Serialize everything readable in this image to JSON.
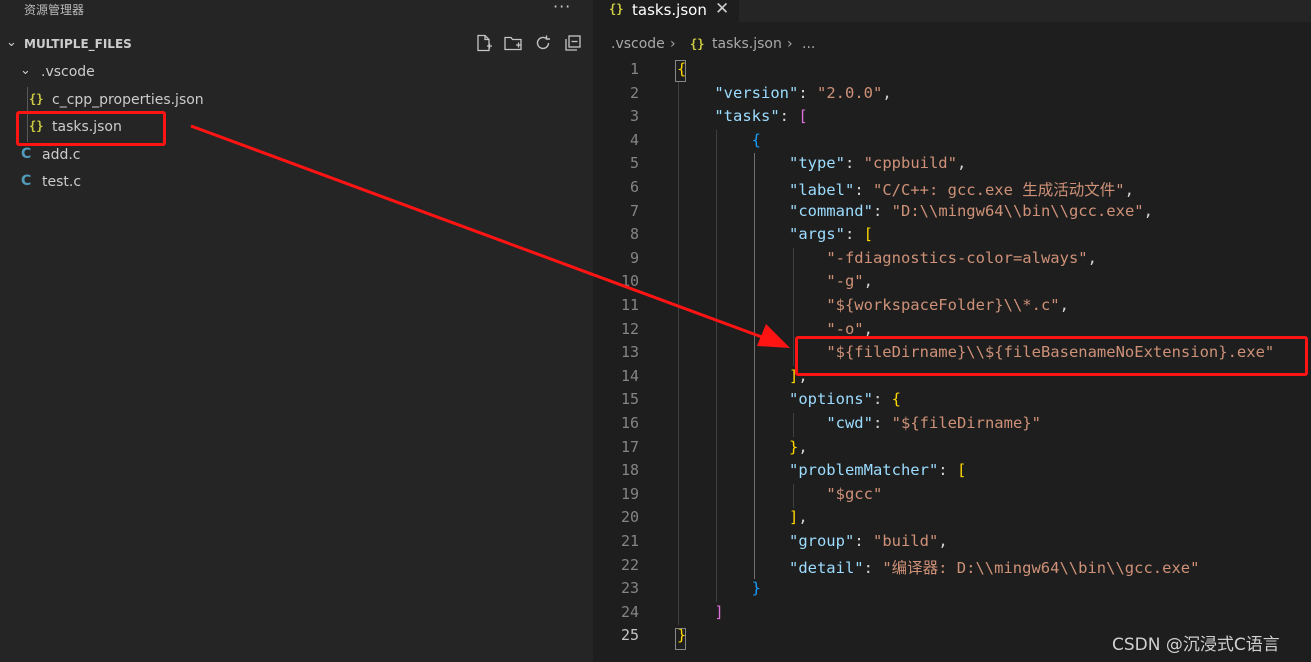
{
  "sidebar": {
    "title": "资源管理器",
    "more": "···",
    "section": {
      "name": "MULTIPLE_FILES"
    },
    "actions": [
      "new-file-icon",
      "new-folder-icon",
      "refresh-icon",
      "collapse-all-icon"
    ],
    "tree": [
      {
        "label": ".vscode",
        "type": "folder"
      },
      {
        "label": "c_cpp_properties.json",
        "type": "json",
        "icon": "{}"
      },
      {
        "label": "tasks.json",
        "type": "json",
        "icon": "{}"
      },
      {
        "label": "add.c",
        "type": "c",
        "icon": "C"
      },
      {
        "label": "test.c",
        "type": "c",
        "icon": "C"
      }
    ]
  },
  "editor": {
    "tab": {
      "icon": "{}",
      "label": "tasks.json",
      "close": "✕"
    },
    "breadcrumb": {
      "folder": ".vscode",
      "sep": "›",
      "icon": "{}",
      "file": "tasks.json",
      "rest": "..."
    },
    "code": [
      {
        "n": "1",
        "t": [
          [
            "b1",
            "{"
          ]
        ]
      },
      {
        "n": "2",
        "t": [
          [
            "p",
            "    "
          ],
          [
            "k",
            "\"version\""
          ],
          [
            "p",
            ": "
          ],
          [
            "s",
            "\"2.0.0\""
          ],
          [
            "p",
            ","
          ]
        ]
      },
      {
        "n": "3",
        "t": [
          [
            "p",
            "    "
          ],
          [
            "k",
            "\"tasks\""
          ],
          [
            "p",
            ": "
          ],
          [
            "b2",
            "["
          ]
        ]
      },
      {
        "n": "4",
        "t": [
          [
            "p",
            "        "
          ],
          [
            "b3",
            "{"
          ]
        ]
      },
      {
        "n": "5",
        "t": [
          [
            "p",
            "            "
          ],
          [
            "k",
            "\"type\""
          ],
          [
            "p",
            ": "
          ],
          [
            "s",
            "\"cppbuild\""
          ],
          [
            "p",
            ","
          ]
        ]
      },
      {
        "n": "6",
        "t": [
          [
            "p",
            "            "
          ],
          [
            "k",
            "\"label\""
          ],
          [
            "p",
            ": "
          ],
          [
            "s",
            "\"C/C++: gcc.exe 生成活动文件\""
          ],
          [
            "p",
            ","
          ]
        ]
      },
      {
        "n": "7",
        "t": [
          [
            "p",
            "            "
          ],
          [
            "k",
            "\"command\""
          ],
          [
            "p",
            ": "
          ],
          [
            "s",
            "\"D:\\\\mingw64\\\\bin\\\\gcc.exe\""
          ],
          [
            "p",
            ","
          ]
        ]
      },
      {
        "n": "8",
        "t": [
          [
            "p",
            "            "
          ],
          [
            "k",
            "\"args\""
          ],
          [
            "p",
            ": "
          ],
          [
            "b1",
            "["
          ]
        ]
      },
      {
        "n": "9",
        "t": [
          [
            "p",
            "                "
          ],
          [
            "s",
            "\"-fdiagnostics-color=always\""
          ],
          [
            "p",
            ","
          ]
        ]
      },
      {
        "n": "10",
        "t": [
          [
            "p",
            "                "
          ],
          [
            "s",
            "\"-g\""
          ],
          [
            "p",
            ","
          ]
        ]
      },
      {
        "n": "11",
        "t": [
          [
            "p",
            "                "
          ],
          [
            "s",
            "\"${workspaceFolder}\\\\*.c\""
          ],
          [
            "p",
            ","
          ]
        ]
      },
      {
        "n": "12",
        "t": [
          [
            "p",
            "                "
          ],
          [
            "s",
            "\"-o\""
          ],
          [
            "p",
            ","
          ]
        ]
      },
      {
        "n": "13",
        "t": [
          [
            "p",
            "                "
          ],
          [
            "s",
            "\"${fileDirname}\\\\${fileBasenameNoExtension}.exe\""
          ]
        ]
      },
      {
        "n": "14",
        "t": [
          [
            "p",
            "            "
          ],
          [
            "b1",
            "]"
          ],
          [
            "p",
            ","
          ]
        ]
      },
      {
        "n": "15",
        "t": [
          [
            "p",
            "            "
          ],
          [
            "k",
            "\"options\""
          ],
          [
            "p",
            ": "
          ],
          [
            "b1",
            "{"
          ]
        ]
      },
      {
        "n": "16",
        "t": [
          [
            "p",
            "                "
          ],
          [
            "k",
            "\"cwd\""
          ],
          [
            "p",
            ": "
          ],
          [
            "s",
            "\"${fileDirname}\""
          ]
        ]
      },
      {
        "n": "17",
        "t": [
          [
            "p",
            "            "
          ],
          [
            "b1",
            "}"
          ],
          [
            "p",
            ","
          ]
        ]
      },
      {
        "n": "18",
        "t": [
          [
            "p",
            "            "
          ],
          [
            "k",
            "\"problemMatcher\""
          ],
          [
            "p",
            ": "
          ],
          [
            "b1",
            "["
          ]
        ]
      },
      {
        "n": "19",
        "t": [
          [
            "p",
            "                "
          ],
          [
            "s",
            "\"$gcc\""
          ]
        ]
      },
      {
        "n": "20",
        "t": [
          [
            "p",
            "            "
          ],
          [
            "b1",
            "]"
          ],
          [
            "p",
            ","
          ]
        ]
      },
      {
        "n": "21",
        "t": [
          [
            "p",
            "            "
          ],
          [
            "k",
            "\"group\""
          ],
          [
            "p",
            ": "
          ],
          [
            "s",
            "\"build\""
          ],
          [
            "p",
            ","
          ]
        ]
      },
      {
        "n": "22",
        "t": [
          [
            "p",
            "            "
          ],
          [
            "k",
            "\"detail\""
          ],
          [
            "p",
            ": "
          ],
          [
            "s",
            "\"编译器: D:\\\\mingw64\\\\bin\\\\gcc.exe\""
          ]
        ]
      },
      {
        "n": "23",
        "t": [
          [
            "p",
            "        "
          ],
          [
            "b3",
            "}"
          ]
        ]
      },
      {
        "n": "24",
        "t": [
          [
            "p",
            "    "
          ],
          [
            "b2",
            "]"
          ]
        ]
      },
      {
        "n": "25",
        "t": [
          [
            "b1",
            "}"
          ]
        ]
      }
    ],
    "active_line": "25"
  },
  "colors": {
    "annotation": "#ff1414",
    "sidebar_bg": "#252526",
    "editor_bg": "#1e1e1e"
  },
  "watermark": "CSDN @沉浸式C语言"
}
